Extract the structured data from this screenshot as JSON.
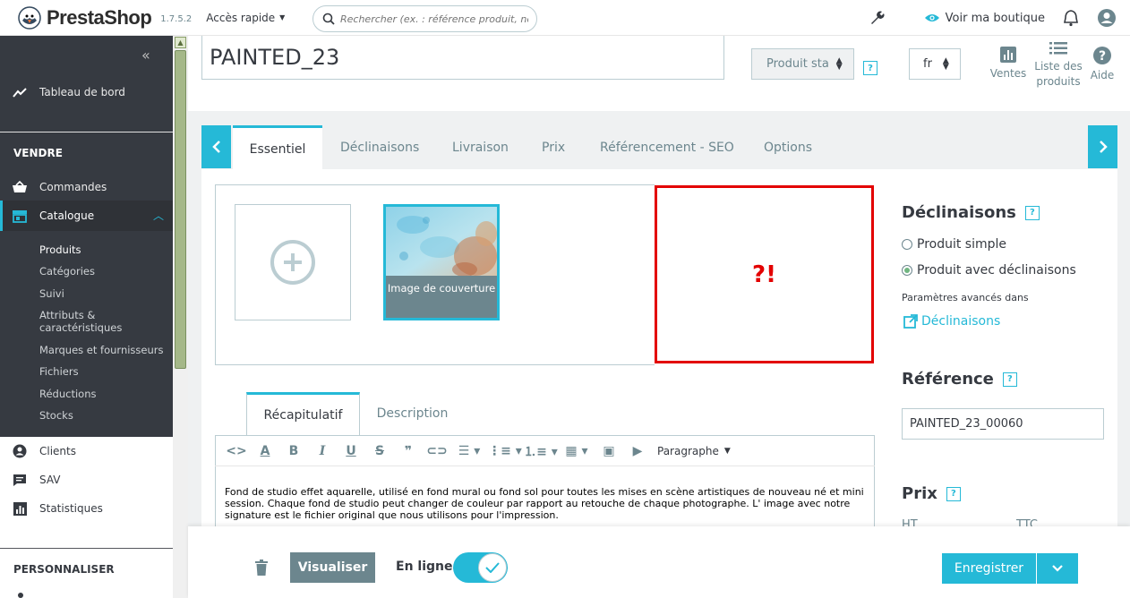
{
  "header": {
    "brand": "PrestaShop",
    "version": "1.7.5.2",
    "quick_access": "Accès rapide",
    "search_placeholder": "Rechercher (ex. : référence produit, nom",
    "view_shop": "Voir ma boutique"
  },
  "sidebar": {
    "dashboard": "Tableau de bord",
    "section_sell": "VENDRE",
    "orders": "Commandes",
    "catalog": "Catalogue",
    "catalog_sub": [
      "Produits",
      "Catégories",
      "Suivi",
      "Attributs & caractéristiques",
      "Marques et fournisseurs",
      "Fichiers",
      "Réductions",
      "Stocks"
    ],
    "customers": "Clients",
    "sav": "SAV",
    "stats": "Statistiques",
    "section_customize": "PERSONNALISER"
  },
  "product": {
    "name": "PAINTED_23",
    "type_select": "Produit sta",
    "lang": "fr"
  },
  "toolbar": {
    "sales": "Ventes",
    "product_list": "Liste des produits",
    "help": "Aide"
  },
  "tabs": [
    "Essentiel",
    "Déclinaisons",
    "Livraison",
    "Prix",
    "Référencement - SEO",
    "Options"
  ],
  "images": {
    "cover_caption": "Image de couverture",
    "error_glyph": "?!"
  },
  "combinations": {
    "title": "Déclinaisons",
    "option_simple": "Produit simple",
    "option_combos": "Produit avec déclinaisons",
    "advanced": "Paramètres avancés dans",
    "link": "Déclinaisons",
    "selected": "Produit avec déclinaisons"
  },
  "reference": {
    "title": "Référence",
    "value": "PAINTED_23_00060"
  },
  "price": {
    "title": "Prix",
    "ht": "HT",
    "ttc": "TTC"
  },
  "editor": {
    "tab_summary": "Récapitulatif",
    "tab_description": "Description",
    "format": "Paragraphe",
    "text": "Fond de studio effet aquarelle, utilisé en fond mural ou fond sol pour toutes les mises en scène artistiques de nouveau né et mini session. Chaque fond de studio peut changer de couleur par rapport au retouche de chaque photographe. L' image avec notre signature est le fichier original que nous utilisons pour l'impression."
  },
  "footer": {
    "preview": "Visualiser",
    "online": "En ligne",
    "online_state": true,
    "save": "Enregistrer"
  },
  "colors": {
    "accent": "#25b9d7",
    "sidebar": "#363a41",
    "error": "#e30000"
  }
}
